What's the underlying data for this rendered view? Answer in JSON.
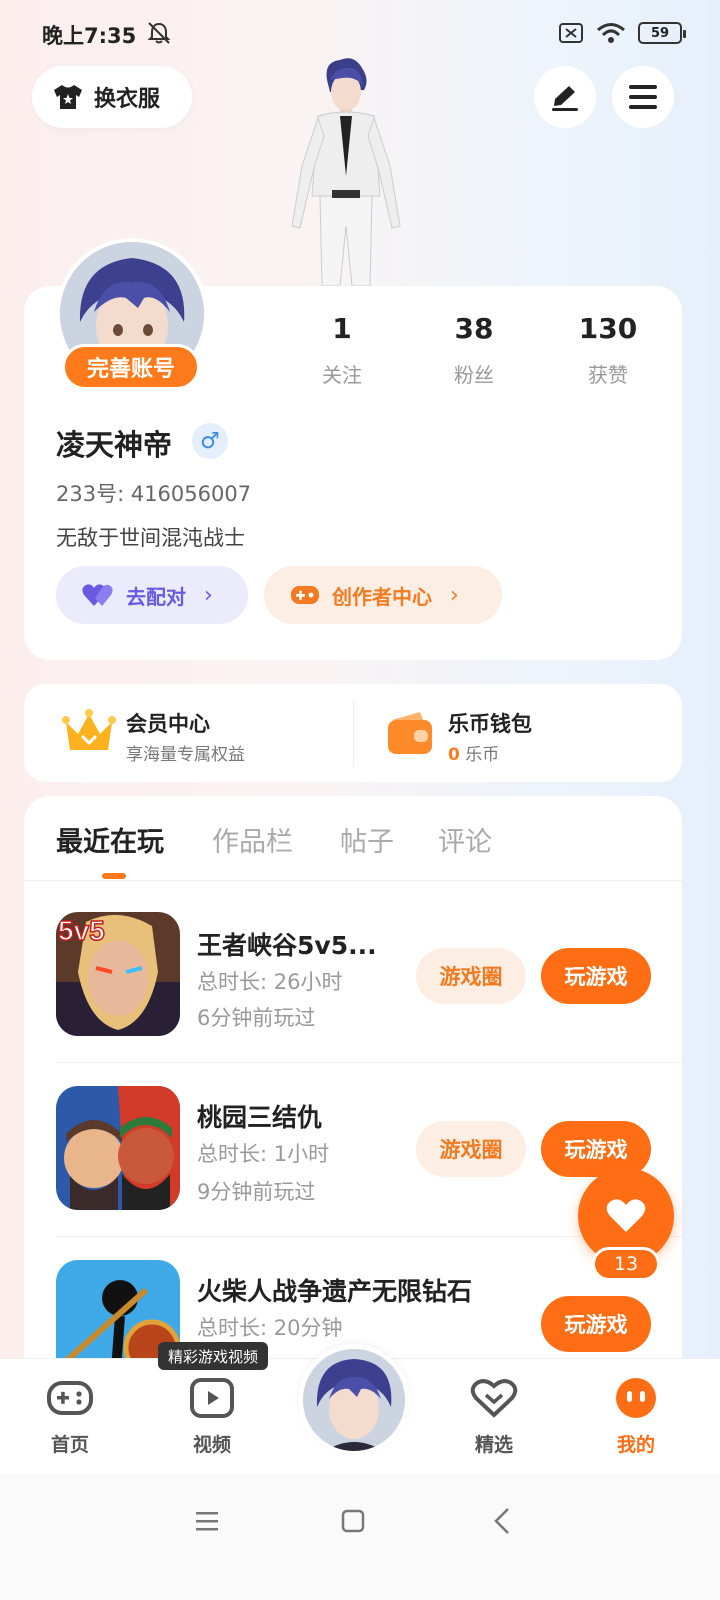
{
  "status_bar": {
    "time": "晚上7:35",
    "battery": "59"
  },
  "header": {
    "outfit_label": "换衣服"
  },
  "profile": {
    "complete_label": "完善账号",
    "stats": [
      {
        "value": "1",
        "label": "关注"
      },
      {
        "value": "38",
        "label": "粉丝"
      },
      {
        "value": "130",
        "label": "获赞"
      }
    ],
    "nickname": "凌天神帝",
    "gender_symbol": "♂",
    "uid": "233号: 416056007",
    "bio": "无敌于世间混沌战士",
    "pair_label": "去配对",
    "creator_label": "创作者中心"
  },
  "vip": {
    "member_title": "会员中心",
    "member_sub": "享海量专属权益",
    "wallet_title": "乐币钱包",
    "wallet_amount": "0",
    "wallet_unit": "乐币"
  },
  "tabs": [
    "最近在玩",
    "作品栏",
    "帖子",
    "评论"
  ],
  "games": [
    {
      "name": "王者峡谷5v5...",
      "duration": "总时长: 26小时",
      "last_played": "6分钟前玩过",
      "circle_label": "游戏圈",
      "play_label": "玩游戏",
      "icon_badge": "5v5"
    },
    {
      "name": "桃园三结仇",
      "duration": "总时长: 1小时",
      "last_played": "9分钟前玩过",
      "circle_label": "游戏圈",
      "play_label": "玩游戏"
    },
    {
      "name": "火柴人战争遗产无限钻石",
      "duration": "总时长: 20分钟",
      "play_label": "玩游戏"
    }
  ],
  "like_float": {
    "count": "13"
  },
  "bottom_nav": {
    "tooltip": "精彩游戏视频",
    "items": [
      {
        "label": "首页",
        "icon": "gamepad-icon"
      },
      {
        "label": "视频",
        "icon": "video-icon"
      },
      {
        "label": "精选",
        "icon": "heart-badge-icon"
      },
      {
        "label": "我的",
        "icon": "face-icon"
      }
    ]
  },
  "colors": {
    "accent": "#ff6e14",
    "purple": "#6a5ae0",
    "background": "#fbf3f3"
  }
}
